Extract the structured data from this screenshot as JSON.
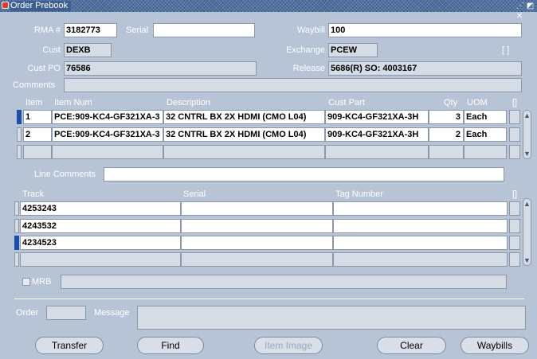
{
  "window": {
    "title": "Order Prebook",
    "controls": "⋰ ◩ ✕"
  },
  "header": {
    "rma_label": "RMA #",
    "rma_value": "3182773",
    "serial_label": "Serial",
    "serial_value": "",
    "waybill_label": "Waybill",
    "waybill_value": "100",
    "cust_label": "Cust",
    "cust_value": "DEXB",
    "exchange_label": "Exchange",
    "exchange_value": "PCEW",
    "bracket": "[ ]",
    "custpo_label": "Cust PO",
    "custpo_value": "76586",
    "release_label": "Release",
    "release_value": "5686(R) SO: 4003167",
    "comments_label": "Comments",
    "comments_value": ""
  },
  "items_table": {
    "headers": {
      "item": "Item",
      "item_num": "Item Num",
      "description": "Description",
      "cust_part": "Cust Part",
      "qty": "Qty",
      "uom": "UOM",
      "more": "[]"
    },
    "rows": [
      {
        "item": "1",
        "item_num": "PCE:909-KC4-GF321XA-3",
        "description": "32 CNTRL BX 2X HDMI  (CMO L04)",
        "cust_part": "909-KC4-GF321XA-3H",
        "qty": "3",
        "uom": "Each"
      },
      {
        "item": "2",
        "item_num": "PCE:909-KC4-GF321XA-3",
        "description": "32 CNTRL BX 2X HDMI  (CMO L04)",
        "cust_part": "909-KC4-GF321XA-3H",
        "qty": "2",
        "uom": "Each"
      },
      {
        "item": "",
        "item_num": "",
        "description": "",
        "cust_part": "",
        "qty": "",
        "uom": ""
      }
    ]
  },
  "line_comments": {
    "label": "Line Comments",
    "value": ""
  },
  "track_table": {
    "headers": {
      "track": "Track",
      "serial": "Serial",
      "tag_number": "Tag Number",
      "more": "[]"
    },
    "rows": [
      {
        "track": "4253243",
        "serial": "",
        "tag": ""
      },
      {
        "track": "4243532",
        "serial": "",
        "tag": ""
      },
      {
        "track": "4234523",
        "serial": "",
        "tag": ""
      },
      {
        "track": "",
        "serial": "",
        "tag": ""
      }
    ]
  },
  "mrb": {
    "label": "MRB",
    "value": ""
  },
  "footer": {
    "order_label": "Order",
    "order_value": "",
    "message_label": "Message",
    "message_value": ""
  },
  "buttons": {
    "transfer": "Transfer",
    "find": "Find",
    "item_image": "Item Image",
    "clear": "Clear",
    "waybills": "Waybills"
  },
  "colors": {
    "background": "#b7c4d6",
    "titlebar": "#3d5f91",
    "field_readonly": "#d6dce5",
    "row_indicator": "#1e4fa8"
  }
}
